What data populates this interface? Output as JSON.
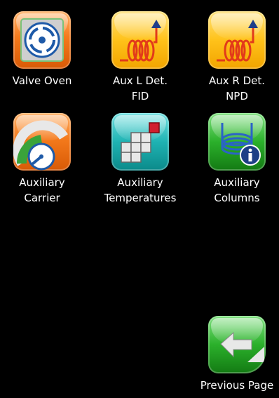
{
  "colors": {
    "background": "#000000",
    "label": "#ffffff"
  },
  "tiles": [
    {
      "name": "valve-oven",
      "label": [
        "Valve Oven",
        ""
      ],
      "icon": "valve-dial-icon",
      "color": "orange"
    },
    {
      "name": "aux-l-det",
      "label": [
        "Aux L Det.",
        "FID"
      ],
      "icon": "detector-coil-icon",
      "color": "yellow"
    },
    {
      "name": "aux-r-det",
      "label": [
        "Aux R Det.",
        "NPD"
      ],
      "icon": "detector-coil-icon",
      "color": "yellow"
    },
    {
      "name": "aux-carrier",
      "label": [
        "Auxiliary",
        "Carrier"
      ],
      "icon": "pressure-gauge-icon",
      "color": "orange"
    },
    {
      "name": "aux-temps",
      "label": [
        "Auxiliary",
        "Temperatures"
      ],
      "icon": "temperature-zones-icon",
      "color": "teal"
    },
    {
      "name": "aux-columns",
      "label": [
        "Auxiliary",
        "Columns"
      ],
      "icon": "column-info-icon",
      "color": "green"
    }
  ],
  "navigation": {
    "previous_page_label": "Previous Page",
    "icon": "back-arrow-icon"
  }
}
